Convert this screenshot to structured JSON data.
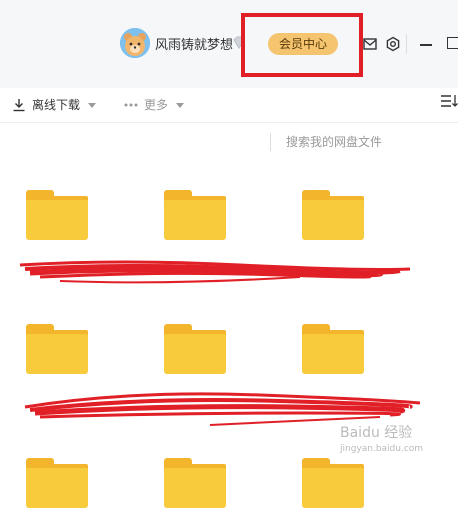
{
  "titlebar": {
    "username": "风雨铸就梦想",
    "member_center_label": "会员中心"
  },
  "toolbar": {
    "offline_download": "离线下载",
    "more": "更多"
  },
  "search": {
    "placeholder": "搜索我的网盘文件"
  },
  "icons": {
    "avatar": "bear-avatar",
    "vip": "diamond-icon",
    "mail": "mail-icon",
    "settings": "gear-icon",
    "minimize": "minimize-icon",
    "download": "download-icon",
    "more": "ellipsis-icon",
    "sort": "sort-list-icon",
    "folder": "folder-icon"
  },
  "colors": {
    "member_button": "#f4c46e",
    "folder": "#f8cb3d",
    "highlight": "#e11f26"
  },
  "watermark": {
    "text": "Baidu 经验",
    "sub": "jingyan.baidu.com"
  }
}
